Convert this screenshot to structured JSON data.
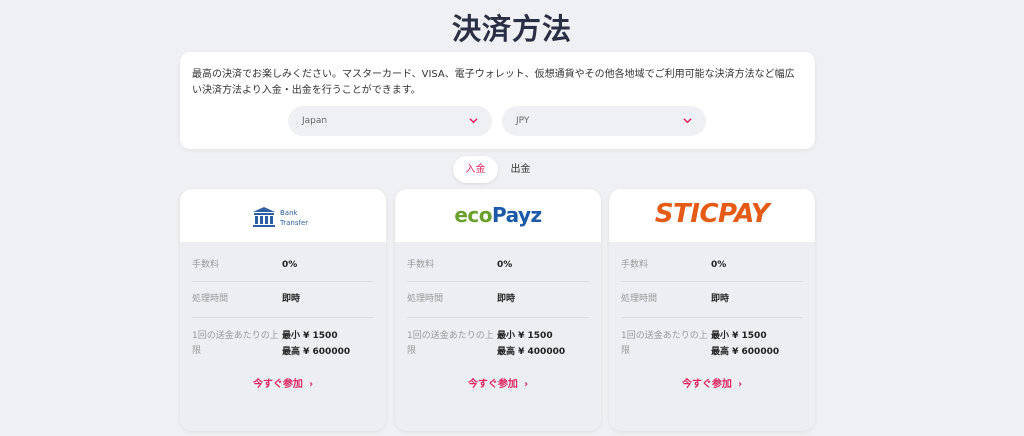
{
  "page": {
    "title": "決済方法",
    "description": "最高の決済でお楽しみください。マスターカード、VISA、電子ウォレット、仮想通貨やその他各地域でご利用可能な決済方法など幅広い決済方法より入金・出金を行うことができます。"
  },
  "filters": {
    "country": "Japan",
    "currency": "JPY"
  },
  "tabs": [
    {
      "label": "入金",
      "active": true
    },
    {
      "label": "出金",
      "active": false
    }
  ],
  "colors": {
    "accent": "#e0245e",
    "background": "#eef0f3",
    "title": "#2b2f45"
  },
  "labels": {
    "fee": "手数料",
    "processing_time": "処理時間",
    "limit": "1回の送金あたりの上限"
  },
  "methods": [
    {
      "logo_icon": "bank-icon",
      "logo_line1": "Bank",
      "logo_line2": "Transfer",
      "fee": "0%",
      "processing": "即時",
      "limit_min": "最小 ¥ 1500",
      "limit_max": "最高 ¥ 600000",
      "cta": "今すぐ参加"
    },
    {
      "logo_part1": "eco",
      "logo_part2": "Payz",
      "fee": "0%",
      "processing": "即時",
      "limit_min": "最小 ¥ 1500",
      "limit_max": "最高 ¥ 400000",
      "cta": "今すぐ参加"
    },
    {
      "logo_text": "STICPAY",
      "fee": "0%",
      "processing": "即時",
      "limit_min": "最小 ¥ 1500",
      "limit_max": "最高 ¥ 600000",
      "cta": "今すぐ参加"
    }
  ]
}
